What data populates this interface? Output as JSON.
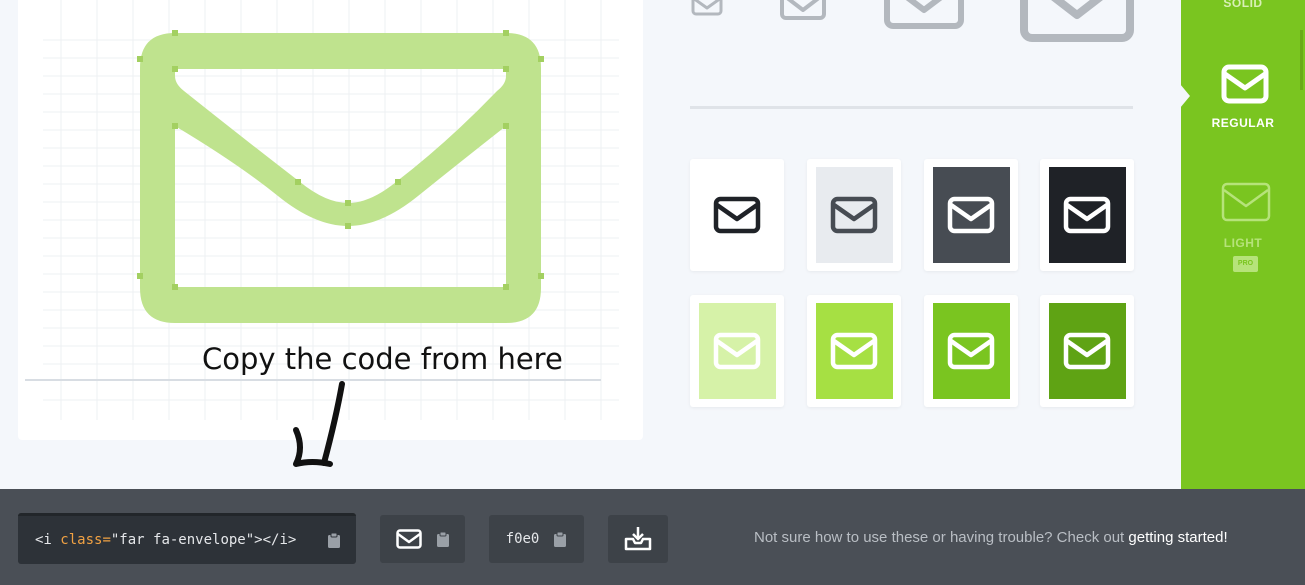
{
  "annotation": {
    "text": "Copy the code from here"
  },
  "styles": {
    "solid_label": "SOLID",
    "regular_label": "REGULAR",
    "light_label": "LIGHT",
    "pro_badge": "PRO"
  },
  "swatches": [
    {
      "bg": "#ffffff",
      "icon": "#1f2227"
    },
    {
      "bg": "#e8ebef",
      "icon": "#474c53"
    },
    {
      "bg": "#474c53",
      "icon": "#ffffff"
    },
    {
      "bg": "#1f2227",
      "icon": "#ffffff"
    },
    {
      "bg": "#d6f2a8",
      "icon": "#ffffff"
    },
    {
      "bg": "#a6e043",
      "icon": "#ffffff"
    },
    {
      "bg": "#7ac520",
      "icon": "#ffffff"
    },
    {
      "bg": "#5fa314",
      "icon": "#ffffff"
    }
  ],
  "code": {
    "tag_open": "<i ",
    "attr": "class=",
    "value": "\"far fa-envelope\"",
    "tag_close": "></i>"
  },
  "unicode": {
    "value": "f0e0"
  },
  "help": {
    "text": "Not sure how to use these or having trouble? Check out ",
    "link": "getting started",
    "suffix": "!"
  },
  "colors": {
    "accent": "#7ac520",
    "bottom_bar": "#4a4f56"
  }
}
